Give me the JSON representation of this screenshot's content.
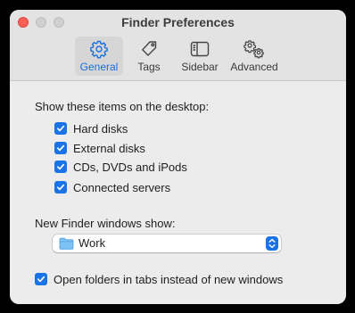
{
  "window": {
    "title": "Finder Preferences"
  },
  "toolbar": {
    "tabs": [
      {
        "label": "General",
        "icon": "gear-icon",
        "selected": true
      },
      {
        "label": "Tags",
        "icon": "tag-icon",
        "selected": false
      },
      {
        "label": "Sidebar",
        "icon": "sidebar-icon",
        "selected": false
      },
      {
        "label": "Advanced",
        "icon": "gears-icon",
        "selected": false
      }
    ]
  },
  "desktop_items": {
    "heading": "Show these items on the desktop:",
    "options": [
      {
        "label": "Hard disks",
        "checked": true
      },
      {
        "label": "External disks",
        "checked": true
      },
      {
        "label": "CDs, DVDs and iPods",
        "checked": true
      },
      {
        "label": "Connected servers",
        "checked": true
      }
    ]
  },
  "new_window": {
    "heading": "New Finder windows show:",
    "selected_value": "Work",
    "icon": "folder-icon"
  },
  "tabs_option": {
    "label": "Open folders in tabs instead of new windows",
    "checked": true
  },
  "colors": {
    "accent": "#1b73e8",
    "close_button": "#fe5f57",
    "window_bg": "#ececec"
  }
}
